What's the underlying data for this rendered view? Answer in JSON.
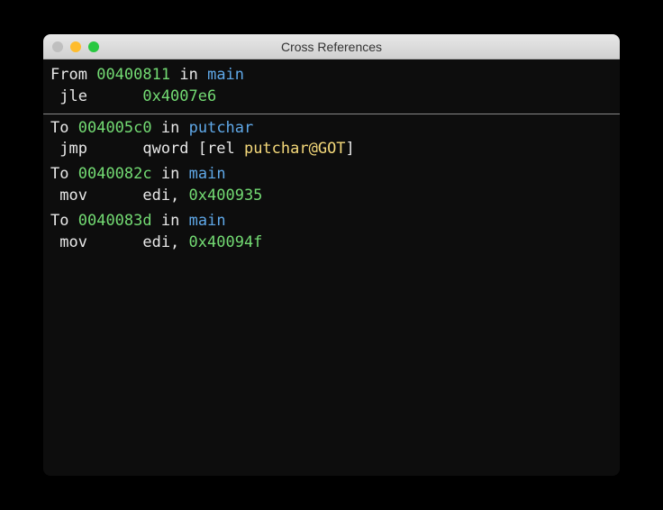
{
  "window": {
    "title": "Cross References"
  },
  "groups": [
    {
      "direction": "From",
      "address": "00400811",
      "in_word": "in",
      "function": "main",
      "mnemonic": "jle",
      "operand_immediate": "0x4007e6",
      "separator": true
    },
    {
      "direction": "To",
      "address": "004005c0",
      "in_word": "in",
      "function": "putchar",
      "mnemonic": "jmp",
      "operand_prefix": "qword [",
      "operand_rel": "rel ",
      "operand_got": "putchar@GOT",
      "operand_suffix": "]"
    },
    {
      "direction": "To",
      "address": "0040082c",
      "in_word": "in",
      "function": "main",
      "mnemonic": "mov",
      "operand_reg": "edi, ",
      "operand_immediate": "0x400935"
    },
    {
      "direction": "To",
      "address": "0040083d",
      "in_word": "in",
      "function": "main",
      "mnemonic": "mov",
      "operand_reg": "edi, ",
      "operand_immediate": "0x40094f"
    }
  ]
}
